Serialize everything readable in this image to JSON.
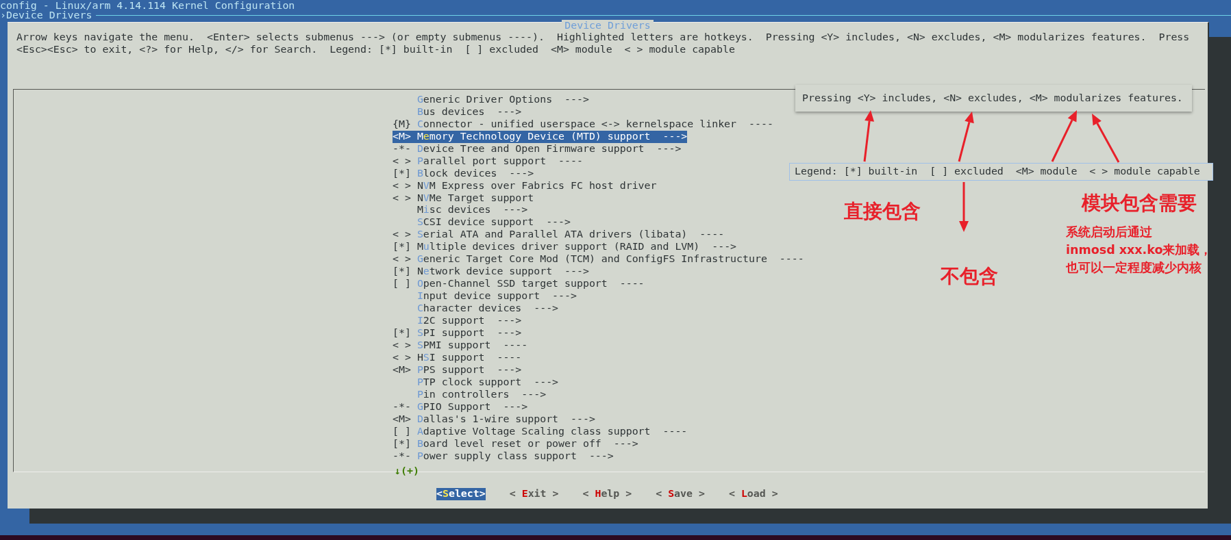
{
  "terminal": {
    "title": "config - Linux/arm 4.14.114 Kernel Configuration",
    "breadcrumb": "›Device Drivers"
  },
  "dialog": {
    "title": "Device Drivers",
    "help_lines": [
      "Arrow keys navigate the menu.  <Enter> selects submenus ---> (or empty submenus ----).  Highlighted letters are hotkeys.  Pressing <Y> includes, <N> excludes, <M> modularizes features.  Press",
      "<Esc><Esc> to exit, <?> for Help, </> for Search.  Legend: [*] built-in  [ ] excluded  <M> module  < > module capable"
    ],
    "menu": {
      "items": [
        {
          "hotkey": "G",
          "after": "eneric Driver Options  --->",
          "selected": false
        },
        {
          "hotkey": "B",
          "after": "us devices  --->",
          "selected": false
        },
        {
          "prefix": "{M}",
          "hotkey": "C",
          "after": "onnector - unified userspace <-> kernelspace linker  ----",
          "selected": false
        },
        {
          "prefix": "<M>",
          "before": "M",
          "hotkey": "e",
          "after": "mory Technology Device (MTD) support  --->",
          "selected": true
        },
        {
          "prefix": "-*-",
          "hotkey": "D",
          "after": "evice Tree and Open Firmware support  --->",
          "selected": false
        },
        {
          "prefix": "< >",
          "hotkey": "P",
          "after": "arallel port support  ----",
          "selected": false
        },
        {
          "prefix": "[*]",
          "hotkey": "B",
          "after": "lock devices  --->",
          "selected": false
        },
        {
          "prefix": "< >",
          "before": "N",
          "hotkey": "V",
          "after": "M Express over Fabrics FC host driver",
          "selected": false
        },
        {
          "prefix": "< >",
          "before": "N",
          "hotkey": "V",
          "after": "Me Target support",
          "selected": false
        },
        {
          "before": "M",
          "hotkey": "i",
          "after": "sc devices  --->",
          "selected": false
        },
        {
          "hotkey": "S",
          "after": "CSI device support  --->",
          "selected": false
        },
        {
          "prefix": "< >",
          "hotkey": "S",
          "after": "erial ATA and Parallel ATA drivers (libata)  ----",
          "selected": false
        },
        {
          "prefix": "[*]",
          "before": "M",
          "hotkey": "u",
          "after": "ltiple devices driver support (RAID and LVM)  --->",
          "selected": false
        },
        {
          "prefix": "< >",
          "hotkey": "G",
          "after": "eneric Target Core Mod (TCM) and ConfigFS Infrastructure  ----",
          "selected": false
        },
        {
          "prefix": "[*]",
          "before": "N",
          "hotkey": "e",
          "after": "twork device support  --->",
          "selected": false
        },
        {
          "prefix": "[ ]",
          "hotkey": "O",
          "after": "pen-Channel SSD target support  ----",
          "selected": false
        },
        {
          "hotkey": "I",
          "after": "nput device support  --->",
          "selected": false
        },
        {
          "hotkey": "C",
          "after": "haracter devices  --->",
          "selected": false
        },
        {
          "hotkey": "I",
          "after": "2C support  --->",
          "selected": false
        },
        {
          "prefix": "[*]",
          "hotkey": "S",
          "after": "PI support  --->",
          "selected": false
        },
        {
          "prefix": "< >",
          "hotkey": "S",
          "after": "PMI support  ----",
          "selected": false
        },
        {
          "prefix": "< >",
          "before": "H",
          "hotkey": "S",
          "after": "I support  ----",
          "selected": false
        },
        {
          "prefix": "<M>",
          "hotkey": "P",
          "after": "PS support  --->",
          "selected": false
        },
        {
          "hotkey": "P",
          "after": "TP clock support  --->",
          "selected": false
        },
        {
          "hotkey": "P",
          "after": "in controllers  --->",
          "selected": false
        },
        {
          "prefix": "-*-",
          "hotkey": "G",
          "after": "PIO Support  --->",
          "selected": false
        },
        {
          "prefix": "<M>",
          "hotkey": "D",
          "after": "allas's 1-wire support  --->",
          "selected": false
        },
        {
          "prefix": "[ ]",
          "hotkey": "A",
          "after": "daptive Voltage Scaling class support  ----",
          "selected": false
        },
        {
          "prefix": "[*]",
          "hotkey": "B",
          "after": "oard level reset or power off  --->",
          "selected": false
        },
        {
          "prefix": "-*-",
          "hotkey": "P",
          "after": "ower supply class support  --->",
          "selected": false
        }
      ],
      "more_indicator": "↓(+)"
    },
    "buttons": [
      {
        "before": "<",
        "hotkey": "S",
        "after": "elect>",
        "selected": true
      },
      {
        "before": "< ",
        "hotkey": "E",
        "after": "xit >",
        "selected": false
      },
      {
        "before": "< ",
        "hotkey": "H",
        "after": "elp >",
        "selected": false
      },
      {
        "before": "< ",
        "hotkey": "S",
        "after": "ave >",
        "selected": false
      },
      {
        "before": "< ",
        "hotkey": "L",
        "after": "oad >",
        "selected": false
      }
    ]
  },
  "annotations": {
    "callouts": [
      {
        "text": "Pressing <Y> includes, <N> excludes, <M> modularizes features."
      },
      {
        "text": "Legend: [*] built-in  [ ] excluded  <M> module  < > module capable"
      }
    ],
    "labels": [
      {
        "text": "直接包含"
      },
      {
        "text": "不包含"
      },
      {
        "text": "模块包含需要"
      }
    ],
    "note_lines": [
      "系统启动后通过",
      "inmosd xxx.ko来加载，",
      "也可以一定程度减少内核"
    ]
  }
}
